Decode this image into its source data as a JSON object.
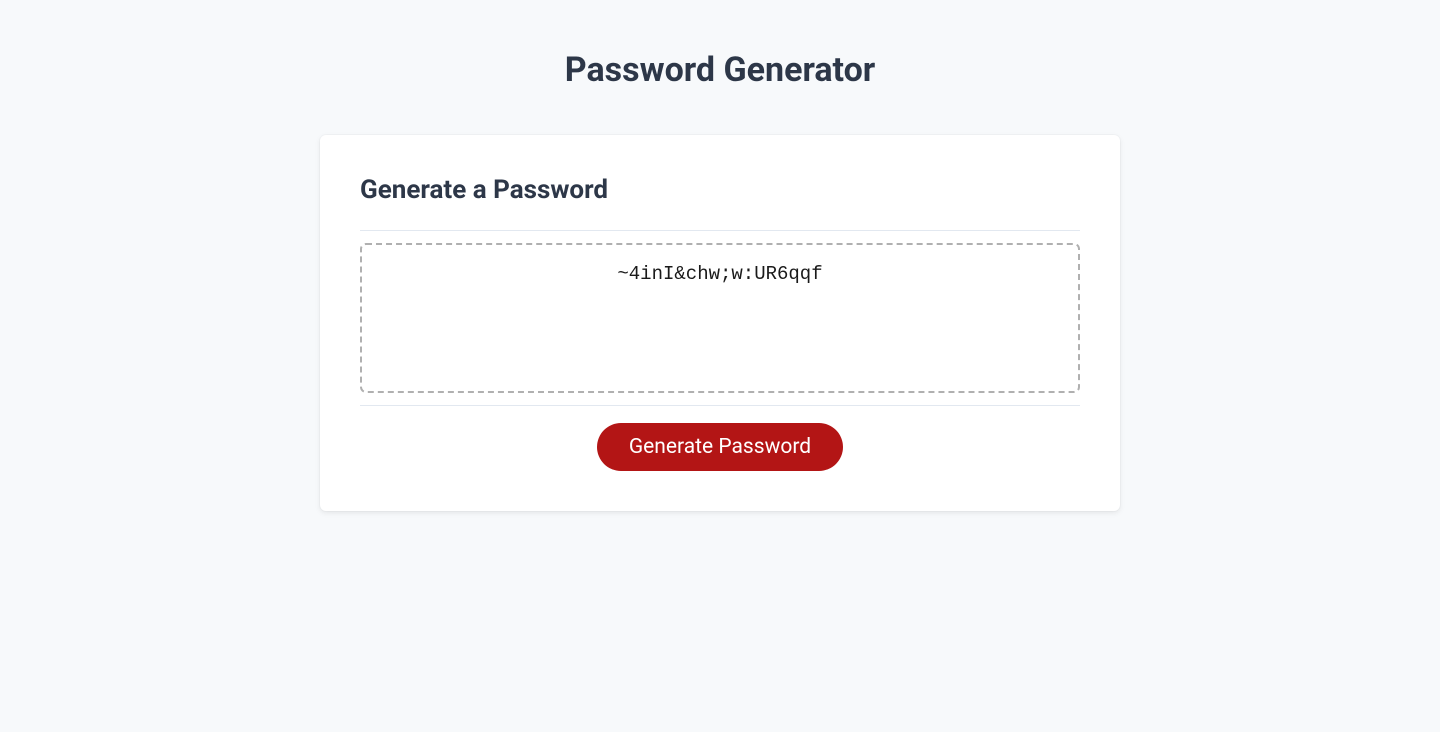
{
  "header": {
    "title": "Password Generator"
  },
  "card": {
    "heading": "Generate a Password",
    "password_value": "~4inI&chw;w:UR6qqf",
    "button_label": "Generate Password"
  }
}
